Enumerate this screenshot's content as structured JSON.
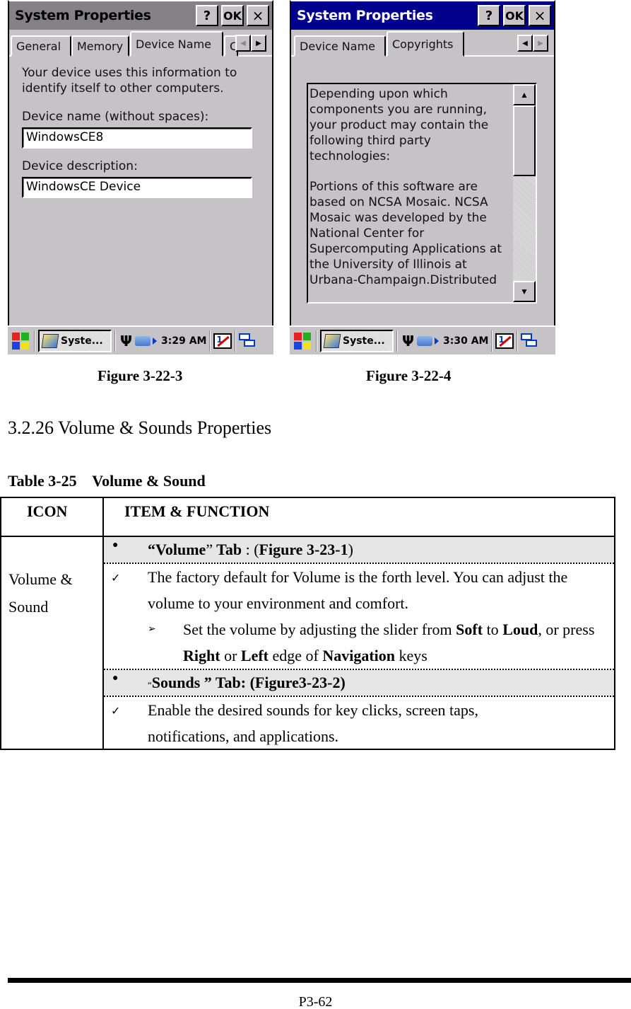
{
  "screenshots": [
    {
      "window_title": "System Properties",
      "buttons": {
        "help": "?",
        "ok": "OK",
        "close": "×"
      },
      "tabs": [
        "General",
        "Memory",
        "Device Name",
        "C"
      ],
      "active_tab": "Device Name",
      "intro": "Your device uses this information to identify itself to other computers.",
      "device_name_label": "Device name (without spaces):",
      "device_name_value": "WindowsCE8",
      "device_description_label": "Device description:",
      "device_description_value": "WindowsCE Device",
      "taskbar": {
        "task_label": "Syste...",
        "clock": "3:29 AM",
        "ime_label": "1"
      }
    },
    {
      "window_title": "System Properties",
      "buttons": {
        "help": "?",
        "ok": "OK",
        "close": "×"
      },
      "tabs": [
        "Device Name",
        "Copyrights"
      ],
      "active_tab": "Copyrights",
      "copyright_text": "Depending upon which\ncomponents you are running,\nyour product may contain the\nfollowing third party\ntechnologies:\n\nPortions of this software are\nbased on NCSA Mosaic. NCSA\nMosaic was developed by the\nNational Center for\nSupercomputing Applications at\nthe University of Illinois at\nUrbana-Champaign.Distributed",
      "taskbar": {
        "task_label": "Syste...",
        "clock": "3:30 AM",
        "ime_label": "1"
      }
    }
  ],
  "captions": [
    "Figure 3-22-3",
    "Figure 3-22-4"
  ],
  "section_heading": "3.2.26 Volume & Sounds Properties",
  "table": {
    "caption": "Table 3-25    Volume & Sound",
    "headers": [
      "ICON",
      "ITEM & FUNCTION"
    ],
    "icon_cell": [
      "Volume &",
      "Sound"
    ],
    "rows": {
      "volume_tab": {
        "q1": "“",
        "name": "Volume",
        "q2": "”",
        "tab": " Tab",
        "sep": " : (",
        "fig": "Figure 3-23-1",
        "end": ")"
      },
      "volume_desc": "The factory default for Volume is the forth level. You can adjust the volume to your environment and comfort.",
      "volume_sub": {
        "p1": "Set the volume by adjusting the slider from ",
        "soft": "Soft",
        "p2": " to ",
        "loud": "Loud",
        "p3": ", or press ",
        "right": "Right",
        "p4": " or ",
        "left": "Left",
        "p5": " edge of ",
        "nav": "Navigation",
        "p6": " keys"
      },
      "sounds_tab": {
        "q1": "“",
        "label": "Sounds ” Tab: (Figure3-23-2)"
      },
      "sounds_desc": "Enable the desired sounds for key clicks, screen taps, notifications, and applications."
    },
    "glyphs": {
      "bullet": "●",
      "check": "✓",
      "arrow": "➢"
    }
  },
  "page_number": "P3-62"
}
